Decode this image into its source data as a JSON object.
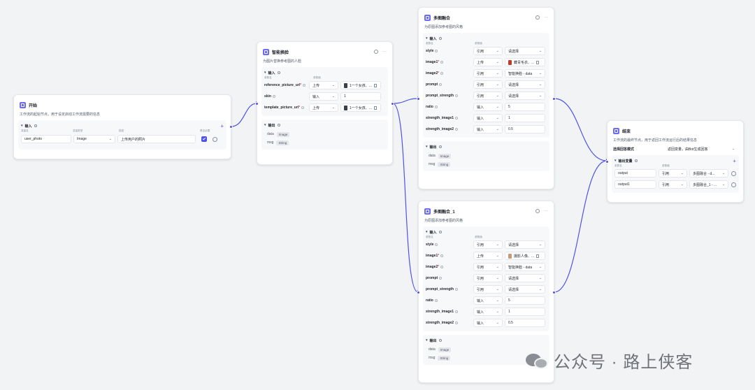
{
  "col_name": "参数名",
  "col_value": "参数值",
  "input_label": "输入",
  "output_label": "输出",
  "start": {
    "title": "开始",
    "desc": "工作流的起始节点，用于设定启动工作流需要的信息",
    "col_var": "变量名",
    "col_type": "变量类型",
    "col_desc": "描述",
    "col_required": "是否必要",
    "var_name": "user_photo",
    "var_type": "Image",
    "var_desc": "上传用户的照片"
  },
  "face": {
    "title": "智能换脸",
    "desc": "为图片替换参考图的人脸",
    "params": [
      {
        "name": "reference_picture_url",
        "req": true,
        "mode": "上传",
        "value": "1一个女孩、...",
        "thumb": "dark",
        "del": true
      },
      {
        "name": "skin",
        "req": false,
        "mode": "输入",
        "value": "1",
        "thumb": "",
        "del": false
      },
      {
        "name": "template_picture_url",
        "req": true,
        "mode": "上传",
        "value": "1一个女孩、...",
        "thumb": "dark",
        "del": true
      }
    ],
    "outputs": [
      {
        "name": "data",
        "type": "Image"
      },
      {
        "name": "msg",
        "type": "String"
      }
    ]
  },
  "fusion": {
    "title": "多图融合",
    "desc": "为原图添加参考图的风格",
    "params": [
      {
        "name": "style",
        "req": false,
        "mode": "引用",
        "value": "请选择",
        "thumb": ""
      },
      {
        "name": "image1",
        "req": true,
        "mode": "上传",
        "value": "藏青毛衣、...",
        "thumb": "red",
        "del": true
      },
      {
        "name": "image2",
        "req": true,
        "mode": "引用",
        "value": "智能换脸 - data",
        "thumb": ""
      },
      {
        "name": "prompt",
        "req": false,
        "mode": "引用",
        "value": "请选择",
        "thumb": ""
      },
      {
        "name": "prompt_strength",
        "req": false,
        "mode": "引用",
        "value": "请选择",
        "thumb": ""
      },
      {
        "name": "ratio",
        "req": false,
        "mode": "输入",
        "value": "5",
        "thumb": ""
      },
      {
        "name": "strength_image1",
        "req": false,
        "mode": "输入",
        "value": "1",
        "thumb": ""
      },
      {
        "name": "strength_image2",
        "req": false,
        "mode": "输入",
        "value": "0.5",
        "thumb": ""
      }
    ],
    "outputs": [
      {
        "name": "data",
        "type": "Image"
      },
      {
        "name": "msg",
        "type": "String"
      }
    ]
  },
  "fusion1": {
    "title": "多图融合_1",
    "desc": "为原图添加参考图的风格",
    "params": [
      {
        "name": "style",
        "req": false,
        "mode": "引用",
        "value": "请选择",
        "thumb": ""
      },
      {
        "name": "image1",
        "req": true,
        "mode": "上传",
        "value": "摄影人像、...",
        "thumb": "skin",
        "del": true
      },
      {
        "name": "image2",
        "req": true,
        "mode": "引用",
        "value": "智能换脸 - data",
        "thumb": ""
      },
      {
        "name": "prompt",
        "req": false,
        "mode": "引用",
        "value": "请选择",
        "thumb": ""
      },
      {
        "name": "prompt_strength",
        "req": false,
        "mode": "引用",
        "value": "请选择",
        "thumb": ""
      },
      {
        "name": "ratio",
        "req": false,
        "mode": "输入",
        "value": "5",
        "thumb": ""
      },
      {
        "name": "strength_image1",
        "req": false,
        "mode": "输入",
        "value": "1",
        "thumb": ""
      },
      {
        "name": "strength_image2",
        "req": false,
        "mode": "输入",
        "value": "0.5",
        "thumb": ""
      }
    ],
    "outputs": [
      {
        "name": "data",
        "type": "Image"
      },
      {
        "name": "msg",
        "type": "String"
      }
    ]
  },
  "end": {
    "title": "结束",
    "desc": "工作流的最终节点，用于返回工作流运行后的结果信息",
    "mode_label": "选择回答模式",
    "mode_value": "返回变量，由Bot生成回答",
    "out_label": "输出变量",
    "outputs": [
      {
        "name": "output",
        "mode": "引用",
        "value": "多图融合 - d..."
      },
      {
        "name": "output1",
        "mode": "引用",
        "value": "多图融合_1 - ..."
      }
    ]
  },
  "watermark": "公众号 · 路上侠客",
  "colors": {
    "accent": "#4d53e8",
    "node_icon": "#6b6cf6",
    "edge": "#4d53e8",
    "canvas": "#f2f3f5"
  },
  "icons": [
    "node-icon",
    "gear-icon",
    "more-icon",
    "info-icon",
    "chevron-down-icon",
    "plus-icon",
    "delete-icon",
    "remove-icon",
    "checkbox-icon",
    "wechat-icon"
  ]
}
